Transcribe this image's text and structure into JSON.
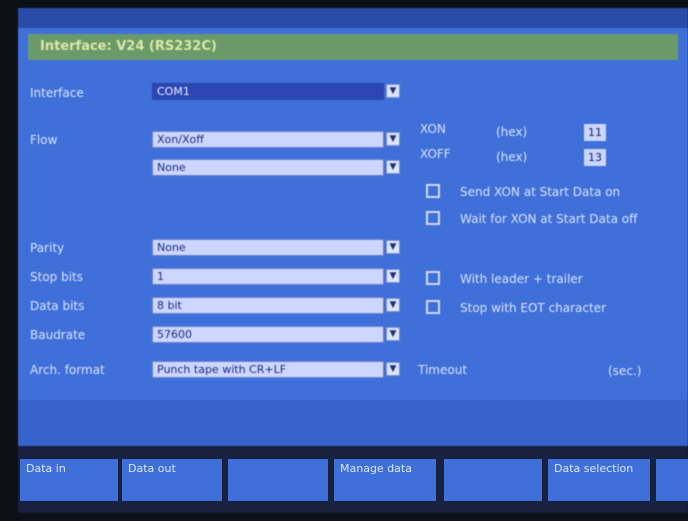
{
  "title": "Interface: V24 (RS232C)",
  "fields": {
    "interface": {
      "label": "Interface",
      "value": "COM1"
    },
    "flow": {
      "label": "Flow",
      "value": "Xon/Xoff"
    },
    "flow2": {
      "label": "",
      "value": "None"
    },
    "parity": {
      "label": "Parity",
      "value": "None"
    },
    "stop_bits": {
      "label": "Stop bits",
      "value": "1"
    },
    "data_bits": {
      "label": "Data bits",
      "value": "8 bit"
    },
    "baudrate": {
      "label": "Baudrate",
      "value": "57600"
    },
    "arch_format": {
      "label": "Arch. format",
      "value": "Punch tape with CR+LF"
    }
  },
  "xon": {
    "label": "XON",
    "unit": "(hex)",
    "value": "11"
  },
  "xoff": {
    "label": "XOFF",
    "unit": "(hex)",
    "value": "13"
  },
  "checkboxes": {
    "send_xon": "Send XON at Start Data on",
    "wait_xon": "Wait for XON at Start Data off",
    "leader_trailer": "With leader + trailer",
    "stop_eot": "Stop with EOT character"
  },
  "timeout": {
    "label": "Timeout",
    "unit": "(sec.)"
  },
  "softkeys": [
    "Data in",
    "Data out",
    "",
    "Manage data",
    "",
    "Data selection",
    ""
  ],
  "icons": {
    "dropdown": "chevron-down-icon"
  }
}
